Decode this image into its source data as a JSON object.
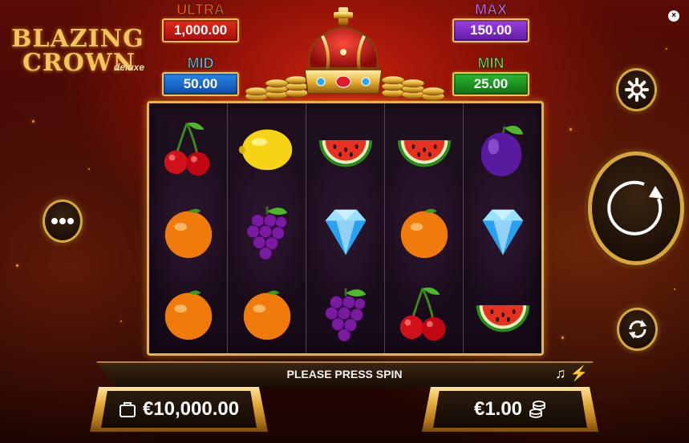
{
  "logo": {
    "line1": "BLAZING",
    "line2": "CROWN",
    "suffix": "deluxe"
  },
  "jackpots": {
    "ultra": {
      "label": "ULTRA",
      "value": "1,000.00"
    },
    "max": {
      "label": "MAX",
      "value": "150.00"
    },
    "mid": {
      "label": "MID",
      "value": "50.00"
    },
    "min": {
      "label": "MIN",
      "value": "25.00"
    }
  },
  "reels": [
    [
      "cherry",
      "orange",
      "orange"
    ],
    [
      "lemon",
      "grapes",
      "orange"
    ],
    [
      "watermelon",
      "diamond",
      "grapes"
    ],
    [
      "watermelon",
      "orange",
      "cherry"
    ],
    [
      "plum",
      "diamond",
      "watermelon"
    ]
  ],
  "controls": {
    "more": "more-icon",
    "settings": "gear-icon",
    "spin": "spin-arrow-icon",
    "autoplay": "autoplay-icon",
    "close": "×"
  },
  "status": {
    "message": "PLEASE PRESS SPIN",
    "music_icon": "♫",
    "turbo_icon": "⚡"
  },
  "balance": {
    "icon": "wallet-icon",
    "value": "€10,000.00"
  },
  "bet": {
    "value": "€1.00",
    "icon": "coins-icon"
  },
  "colors": {
    "gold": "#e9b446",
    "ultra": "#e52a1a",
    "max": "#a040e6",
    "mid": "#2a86e8",
    "min": "#2eb830"
  }
}
